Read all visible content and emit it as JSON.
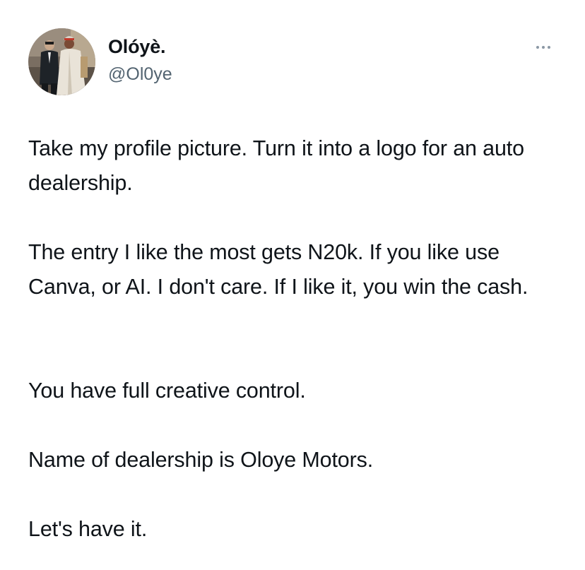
{
  "tweet": {
    "author": {
      "display_name": "Olóyè.",
      "handle": "@Ol0ye",
      "avatar_icon": "profile-photo"
    },
    "menu_icon": "more-options-icon",
    "paragraphs": [
      "Take my profile picture. Turn it into a logo for an auto dealership.",
      "The entry I like the most gets N20k. If you like use Canva, or AI. I don't care. If I like it, you win the cash.",
      "You have full creative control.",
      "Name of dealership is Oloye Motors.",
      "Let's have it."
    ]
  },
  "colors": {
    "text": "#0f1419",
    "secondary_text": "#536471",
    "icon": "#8b98a5",
    "background": "#ffffff"
  }
}
